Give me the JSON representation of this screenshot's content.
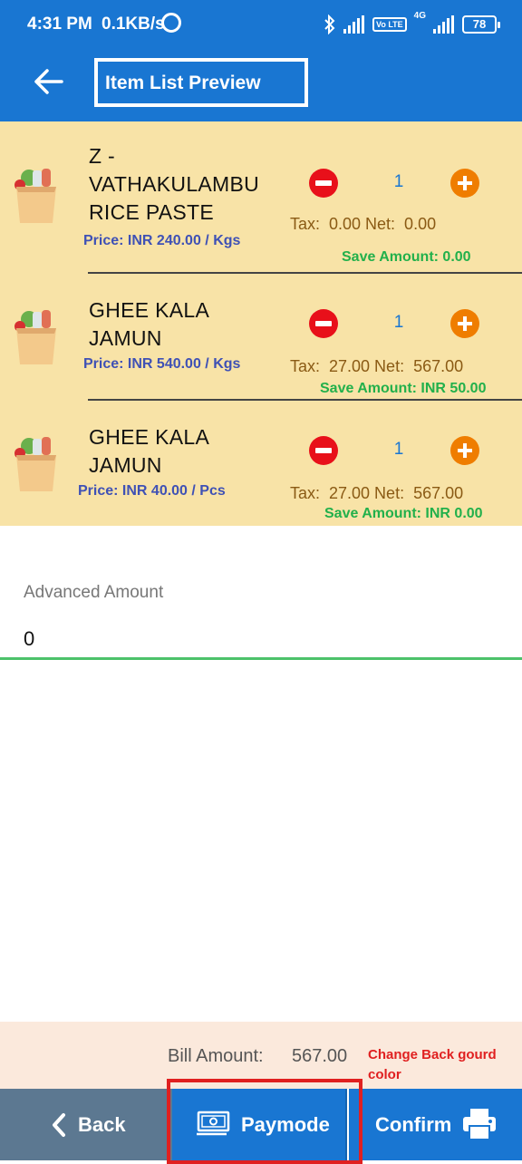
{
  "status_bar": {
    "time": "4:31 PM",
    "speed": "0.1KB/s",
    "volte": "Vo LTE",
    "network": "4G",
    "battery": "78"
  },
  "header": {
    "title": "Item List Preview"
  },
  "items": [
    {
      "name": "Z -\nVATHAKULAMBU\nRICE PASTE",
      "price": "Price: INR 240.00 / Kgs",
      "qty": "1",
      "tax_net": "Tax:  0.00 Net:  0.00",
      "save": "Save Amount: 0.00"
    },
    {
      "name": "GHEE KALA\nJAMUN",
      "price": "Price: INR 540.00 / Kgs",
      "qty": "1",
      "tax_net": "Tax:  27.00 Net:  567.00",
      "save": "Save Amount: INR 50.00"
    },
    {
      "name": "GHEE KALA\nJAMUN",
      "price": "Price: INR 40.00 / Pcs",
      "qty": "1",
      "tax_net": "Tax:  27.00 Net:  567.00",
      "save": "Save Amount: INR 0.00"
    }
  ],
  "advanced_amount": {
    "label": "Advanced Amount",
    "value": "0"
  },
  "bill": {
    "label": "Bill Amount:",
    "value": "567.00",
    "note": "Change Back gourd color"
  },
  "bottom_bar": {
    "back": "Back",
    "paymode": "Paymode",
    "confirm": "Confirm"
  },
  "colors": {
    "primary": "#1976d2",
    "list_bg": "#f8e3a7",
    "minus": "#e8101a",
    "plus": "#ef7d00",
    "price": "#3f51b5",
    "save": "#22b04b",
    "back_button": "#5c7891",
    "annotation": "#e02020"
  },
  "icons": [
    "back-arrow-icon",
    "grocery-bag-icon",
    "minus-icon",
    "plus-icon",
    "chevron-left-icon",
    "cash-icon",
    "printer-icon"
  ]
}
